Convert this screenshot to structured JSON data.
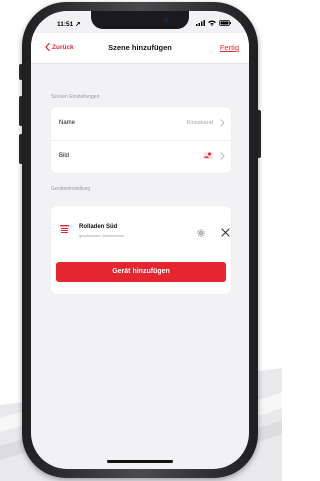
{
  "status_bar": {
    "time": "11:51 ↗"
  },
  "nav": {
    "back_label": "Zurück",
    "title": "Szene hinzufügen",
    "done_label": "Fertig"
  },
  "scene_settings": {
    "header": "Szenen Einstellungen",
    "name_label": "Name",
    "name_value": "Kinoabend",
    "image_label": "Bild",
    "image_icon": "scene-image-preview-icon"
  },
  "device_settings": {
    "header": "Geräteeinstellung",
    "devices": [
      {
        "name": "Rolladen Süd",
        "status": "geschlossen: Wohnzimmer",
        "icon": "shutter-icon"
      }
    ],
    "add_button_label": "Gerät hinzufügen"
  },
  "colors": {
    "accent": "#e3262f",
    "background": "#f2f2f4",
    "card": "#ffffff"
  }
}
